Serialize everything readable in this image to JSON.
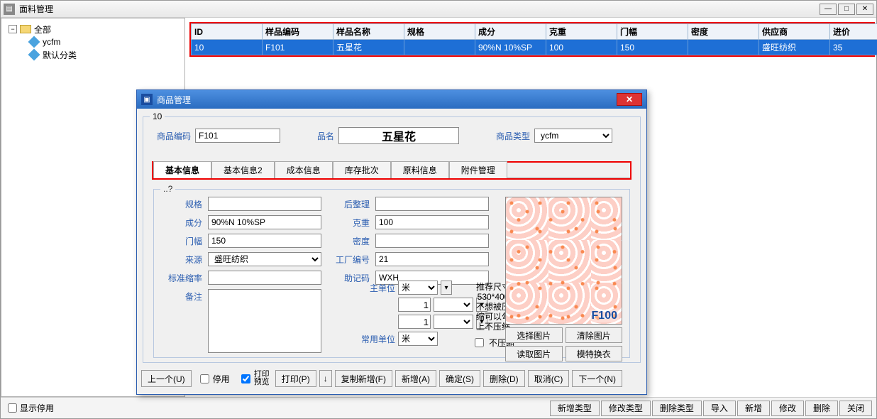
{
  "main": {
    "title": "面料管理",
    "show_stopped_label": "显示停用"
  },
  "tree": {
    "root_label": "全部",
    "items": [
      "ycfm",
      "默认分类"
    ]
  },
  "table": {
    "headers": [
      "ID",
      "样品编码",
      "样品名称",
      "规格",
      "成分",
      "克重",
      "门幅",
      "密度",
      "供应商",
      "进价"
    ],
    "row": [
      "10",
      "F101",
      "五星花",
      "",
      "90%N 10%SP",
      "100",
      "150",
      "",
      "盛旺纺织",
      "35"
    ]
  },
  "bottom_buttons": [
    "新增类型",
    "修改类型",
    "删除类型",
    "导入",
    "新增",
    "修改",
    "删除",
    "关闭"
  ],
  "dialog": {
    "title": "商品管理",
    "group_legend": "10",
    "top": {
      "code_label": "商品编码",
      "code_value": "F101",
      "name_label": "品名",
      "name_value": "五星花",
      "type_label": "商品类型",
      "type_value": "ycfm"
    },
    "tabs": [
      "基本信息",
      "基本信息2",
      "成本信息",
      "库存批次",
      "原料信息",
      "附件管理"
    ],
    "inner_legend": "..?",
    "form": {
      "spec_label": "规格",
      "spec_value": "",
      "finish_label": "后整理",
      "finish_value": "",
      "comp_label": "成分",
      "comp_value": "90%N 10%SP",
      "weight_label": "克重",
      "weight_value": "100",
      "width_label": "门幅",
      "width_value": "150",
      "density_label": "密度",
      "density_value": "",
      "source_label": "来源",
      "source_value": "盛旺纺织",
      "factory_label": "工厂编号",
      "factory_value": "21",
      "shrink_label": "标准缩率",
      "shrink_value": "",
      "mnemonic_label": "助记码",
      "mnemonic_value": "WXH",
      "remark_label": "备注",
      "remark_value": ""
    },
    "units": {
      "main_label": "主单位",
      "main_value": "米",
      "qty1": "1",
      "qty2": "1",
      "common_label": "常用单位",
      "common_value": "米"
    },
    "reco_text": "推荐尺寸\n530*400\n不想被压\n缩可以勾\n上不压缩",
    "compress_label": "不压缩",
    "image_label": "F100",
    "img_buttons1": [
      "选择图片",
      "清除图片"
    ],
    "img_buttons2": [
      "读取图片",
      "模特换衣"
    ],
    "bottom": {
      "prev": "上一个(U)",
      "stop": "停用",
      "preview": "打印\n预览",
      "print": "打印(P)",
      "copyadd": "复制新增(F)",
      "add": "新增(A)",
      "ok": "确定(S)",
      "del": "删除(D)",
      "cancel": "取消(C)",
      "next": "下一个(N)"
    }
  }
}
